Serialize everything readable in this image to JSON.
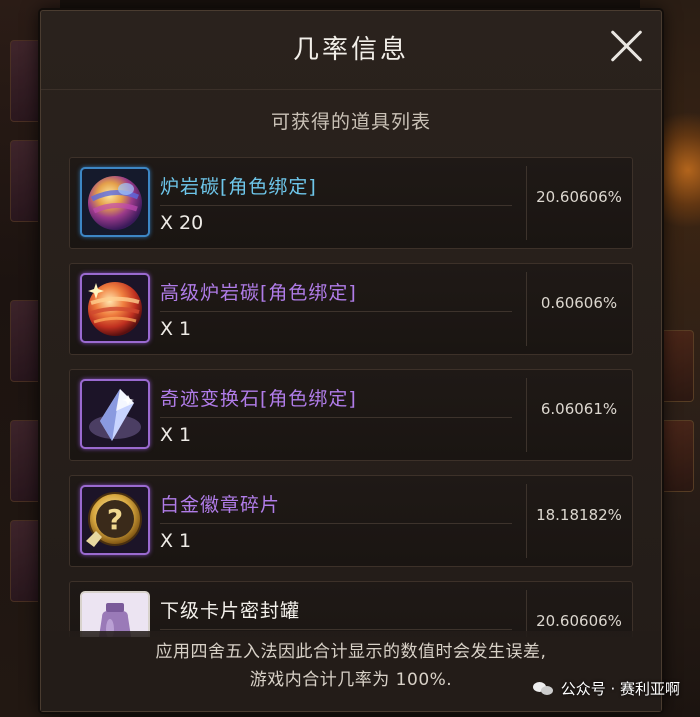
{
  "modal": {
    "title": "几率信息",
    "subtitle": "可获得的道具列表"
  },
  "items": [
    {
      "name": "炉岩碳[角色绑定]",
      "qty": "X 20",
      "rate": "20.60606%",
      "name_color": "blue",
      "icon": "lava-orb-icon"
    },
    {
      "name": "高级炉岩碳[角色绑定]",
      "qty": "X 1",
      "rate": "0.60606%",
      "name_color": "purple",
      "icon": "advanced-lava-orb-icon"
    },
    {
      "name": "奇迹变换石[角色绑定]",
      "qty": "X 1",
      "rate": "6.06061%",
      "name_color": "purple",
      "icon": "crystal-icon"
    },
    {
      "name": "白金徽章碎片",
      "qty": "X 1",
      "rate": "18.18182%",
      "name_color": "purple",
      "icon": "mystery-badge-icon"
    },
    {
      "name": "下级卡片密封罐",
      "qty": "",
      "rate": "20.60606%",
      "name_color": "white",
      "icon": "sealed-jar-icon"
    }
  ],
  "footer": {
    "line1": "应用四舍五入法因此合计显示的数值时会发生误差,",
    "line2": "游戏内合计几率为 100%."
  },
  "watermark": "公众号 · 赛利亚啊"
}
